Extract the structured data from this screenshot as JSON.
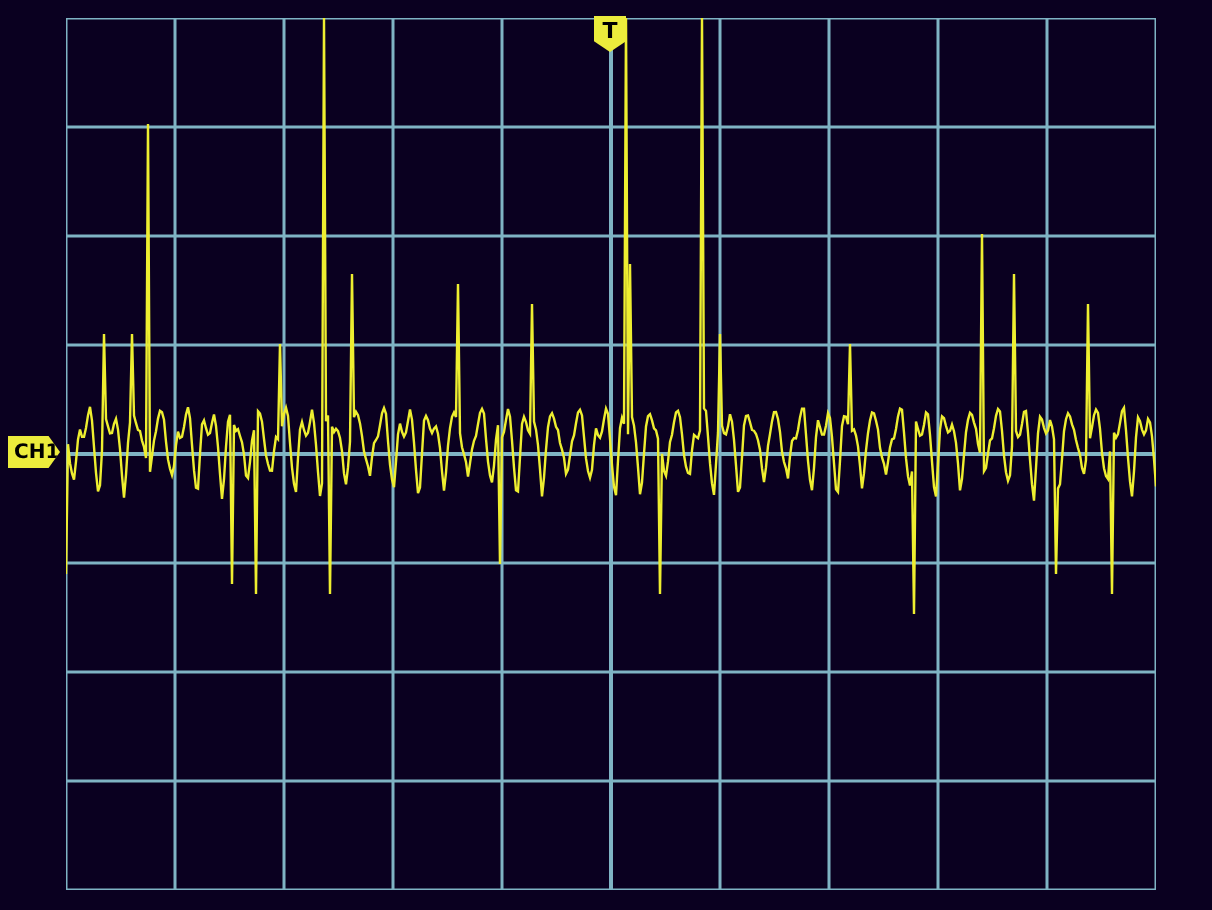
{
  "channel_marker": {
    "label": "CH1"
  },
  "trigger_marker": {
    "label": "T"
  }
}
